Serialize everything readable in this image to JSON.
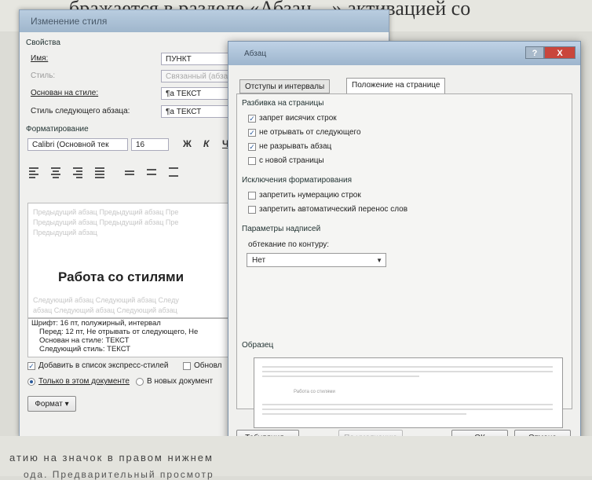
{
  "page_header_text": "бражается в разделе «Абзац…» активацией со",
  "style_dialog": {
    "title": "Изменение стиля",
    "properties_title": "Свойства",
    "name_label": "Имя:",
    "name_value": "ПУНКТ",
    "type_label": "Стиль:",
    "type_value": "Связанный (абзац",
    "based_on_label": "Основан на стиле:",
    "based_on_value": "¶а ТЕКСТ",
    "next_style_label": "Стиль следующего абзаца:",
    "next_style_value": "¶а ТЕКСТ",
    "formatting_title": "Форматирование",
    "font_value": "Calibri (Основной тек",
    "size_value": "16",
    "bold": "Ж",
    "italic": "К",
    "underline": "Ч",
    "preview_prev_lines": [
      "Предыдущий абзац Предыдущий абзац Пре",
      "Предыдущий абзац Предыдущий абзац Пре",
      "Предыдущий абзац"
    ],
    "preview_heading": "Работа со стилями",
    "preview_next_lines": [
      "Следующий абзац Следующий абзац Следу",
      "абзац Следующий абзац Следующий абзац"
    ],
    "description_lines": [
      "Шрифт: 16 пт, полужирный, интервал",
      "Перед: 12 пт, Не отрывать от следующего, Не",
      "Основан на стиле: ТЕКСТ",
      "Следующий стиль: ТЕКСТ"
    ],
    "add_to_gallery": "Добавить в список экспресс-стилей",
    "auto_update": "Обновл",
    "only_this_doc": "Только в этом документе",
    "new_docs": "В новых документ",
    "format_button": "Формат ▾"
  },
  "paragraph_dialog": {
    "title": "Абзац",
    "help_btn": "?",
    "close_btn": "X",
    "tabs": [
      "Отступы и интервалы",
      "Положение на странице"
    ],
    "active_tab": 1,
    "pagination_title": "Разбивка на страницы",
    "pagination": [
      {
        "label": "запрет висячих строк",
        "checked": true
      },
      {
        "label": "не отрывать от следующего",
        "checked": true
      },
      {
        "label": "не разрывать абзац",
        "checked": true
      },
      {
        "label": "с новой страницы",
        "checked": false
      }
    ],
    "exceptions_title": "Исключения форматирования",
    "exceptions": [
      {
        "label": "запретить нумерацию строк",
        "checked": false
      },
      {
        "label": "запретить автоматический перенос слов",
        "checked": false
      }
    ],
    "textbox_title": "Параметры надписей",
    "wrap_label": "обтекание по контуру:",
    "wrap_value": "Нет",
    "sample_title": "Образец",
    "sample_text": "Работа со стилями",
    "tabs_button": "Табуляция...",
    "default_button": "По умолчанию",
    "ok_button": "ОК",
    "cancel_button": "Отмена"
  },
  "page_footer_lines": [
    "атию на значок в правом нижнем",
    "ода. Предварительный просмотр"
  ],
  "colors": {
    "titlebar": "#9fb6cc",
    "close": "#c9463c",
    "check": "#2a5a9a"
  }
}
